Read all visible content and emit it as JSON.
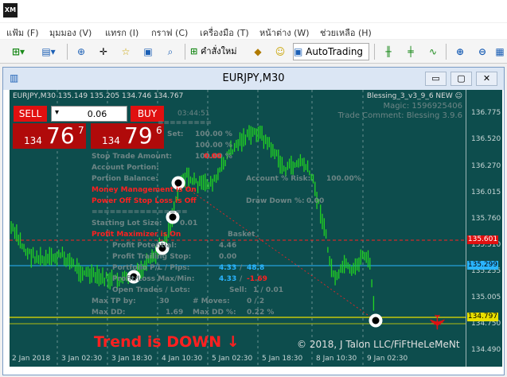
{
  "app": {
    "logo_text": "XM"
  },
  "menu": [
    {
      "label": "แฟ้ม (F)"
    },
    {
      "label": "มุมมอง (V)"
    },
    {
      "label": "แทรก (I)"
    },
    {
      "label": "กราฟ (C)"
    },
    {
      "label": "เครื่องมือ (T)"
    },
    {
      "label": "หน้าต่าง (W)"
    },
    {
      "label": "ช่วยเหลือ (H)"
    }
  ],
  "toolbar": {
    "new_order_label": "คำสั่งใหม่",
    "autotrading_label": "AutoTrading"
  },
  "window": {
    "title": "EURJPY,M30",
    "minimize": "▭",
    "restore": "▢",
    "close": "✕"
  },
  "chart": {
    "header": "EURJPY,M30  135.149 135.205 134.746 134.767",
    "ea_name": "Blessing_3_v3_9_6 NEW",
    "magic": "Magic: 1596925406",
    "comment": "Trade Comment: Blessing 3.9.6",
    "timer": "03:44:51",
    "trend_text": "Trend is DOWN ↓",
    "copyright": "© 2018, J Talon LLC/FiFtHeLeMeNt",
    "price_labels": [
      "136.775",
      "136.520",
      "136.270",
      "136.015",
      "135.760",
      "135.510",
      "135.255",
      "135.005",
      "134.750",
      "134.490"
    ],
    "red_line_price": "135.601",
    "blue_line_price": "135.299",
    "yellow_line_price": "134.797",
    "time_labels": [
      "2 Jan 2018",
      "3 Jan 02:30",
      "3 Jan 18:30",
      "4 Jan 10:30",
      "5 Jan 02:30",
      "5 Jan 18:30",
      "8 Jan 10:30",
      "9 Jan 02:30"
    ]
  },
  "trade_panel": {
    "sell_label": "SELL",
    "buy_label": "BUY",
    "lot": "0.06",
    "bid_small": "134",
    "bid_big": "76",
    "bid_sup": "7",
    "ask_small": "134",
    "ask_big": "79",
    "ask_sup": "6"
  },
  "overlay": {
    "sep1": "=========",
    "set_label": "Set:",
    "set_vals": [
      "100.00 %",
      "100.00 %",
      "100.00 %"
    ],
    "stop_trade_amount": "Stop Trade Amount:",
    "stop_trade_val": "0.00",
    "account_portion": "Account Portion:",
    "portion_balance": "Portion Balance:",
    "portion_balance_val": "…",
    "account_pct_label": "Account % Risk:",
    "account_pct_val": "100.00%",
    "mm_on": "Money Management is On",
    "power_off": "Power Off Stop Loss is Off",
    "draw_down": "Draw Down %:",
    "draw_down_val": "0.00",
    "sep2": "================",
    "starting_lot": "Starting Lot Size:",
    "starting_lot_val": "0.01",
    "profit_max": "Profit Maximizer is On",
    "basket": "Basket",
    "profit_potential": "Profit Potential:",
    "profit_potential_val": "4.46",
    "profit_trailing": "Profit Trailing Stop:",
    "profit_trailing_val": "0.00",
    "portfolio_pl": "Portfolio P/L / Pips:",
    "portfolio_pl_val1": "4.33",
    "portfolio_pl_val2": "48.8",
    "profit_loss_max": "Profit/Loss Max/Min:",
    "profit_loss_max_val1": "4.33",
    "profit_loss_max_val2": "-1.69",
    "open_trades": "Open Trades / Lots:",
    "open_trades_sell": "Sell:",
    "open_trades_val": "1 / 0.01",
    "max_tp": "Max TP by:",
    "max_tp_val": "30",
    "moves": "# Moves:",
    "moves_val": "0 / 2",
    "max_dd": "Max DD:",
    "max_dd_val": "1.69",
    "max_dd_pct": "Max DD %:",
    "max_dd_pct_val": "0.22 %"
  },
  "colors": {
    "chart_bg": "#0d4d4d",
    "candle": "#22d422",
    "red": "#ff2020",
    "blue": "#2ab5ff",
    "yellow": "#e8e000"
  }
}
